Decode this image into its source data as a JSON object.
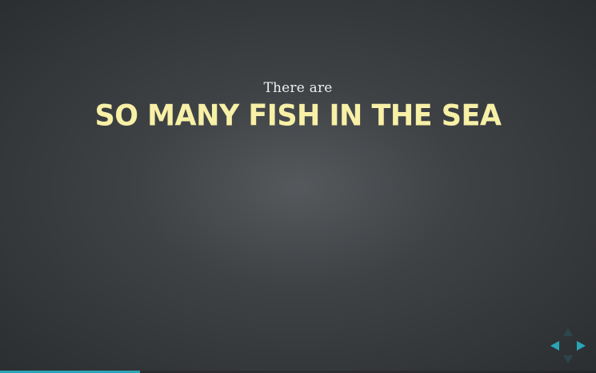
{
  "slide": {
    "subtitle": "There are",
    "title": "SO MANY FISH IN THE SEA"
  },
  "controls": {
    "left": "arrow-left-icon",
    "right": "arrow-right-icon",
    "up": "arrow-up-icon",
    "down": "arrow-down-icon",
    "active_color": "#2aa5b8",
    "inactive_color": "#2b4a50"
  },
  "progress": {
    "fraction": 0.235,
    "color": "#2aa5b8"
  },
  "colors": {
    "title": "#f7f0a6",
    "subtitle": "#eeeeee",
    "background": "#3f4245"
  }
}
